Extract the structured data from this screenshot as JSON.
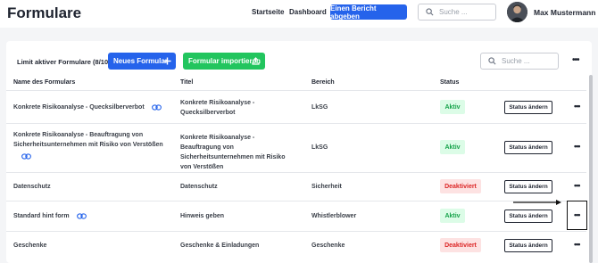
{
  "header": {
    "title": "Formulare",
    "nav": [
      "Startseite",
      "Dashboard"
    ],
    "cta_label": "Einen Bericht abgeben",
    "search_placeholder": "Suche ...",
    "user_name": "Max Mustermann"
  },
  "toolbar": {
    "limit_label": "Limit aktiver Formulare (8/10)",
    "new_form_label": "Neues Formular",
    "import_label": "Formular importieren",
    "search_placeholder": "Suche ..."
  },
  "table": {
    "columns": [
      "Name des Formulars",
      "Titel",
      "Bereich",
      "Status"
    ],
    "status_button_label": "Status ändern",
    "rows": [
      {
        "name": "Konkrete Risikoanalyse - Quecksilberverbot",
        "title": "Konkrete Risikoanalyse - Quecksilberverbot",
        "area": "LkSG",
        "status": "Aktiv"
      },
      {
        "name": "Konkrete Risikoanalyse - Beauftragung von Sicherheitsunternehmen mit Risiko von Verstößen",
        "title": "Konkrete Risikoanalyse - Beauftragung von Sicherheitsunternehmen mit Risiko von Verstößen",
        "area": "LkSG",
        "status": "Aktiv"
      },
      {
        "name": "Datenschutz",
        "title": "Datenschutz",
        "area": "Sicherheit",
        "status": "Deaktiviert"
      },
      {
        "name": "Standard hint form",
        "title": "Hinweis geben",
        "area": "Whistlerblower",
        "status": "Aktiv"
      },
      {
        "name": "Geschenke",
        "title": "Geschenke & Einladungen",
        "area": "Geschenke",
        "status": "Deaktiviert"
      }
    ]
  },
  "colors": {
    "primary": "#2563eb",
    "success": "#22c55e",
    "active": "#16a34a",
    "inactive": "#dc2626"
  }
}
